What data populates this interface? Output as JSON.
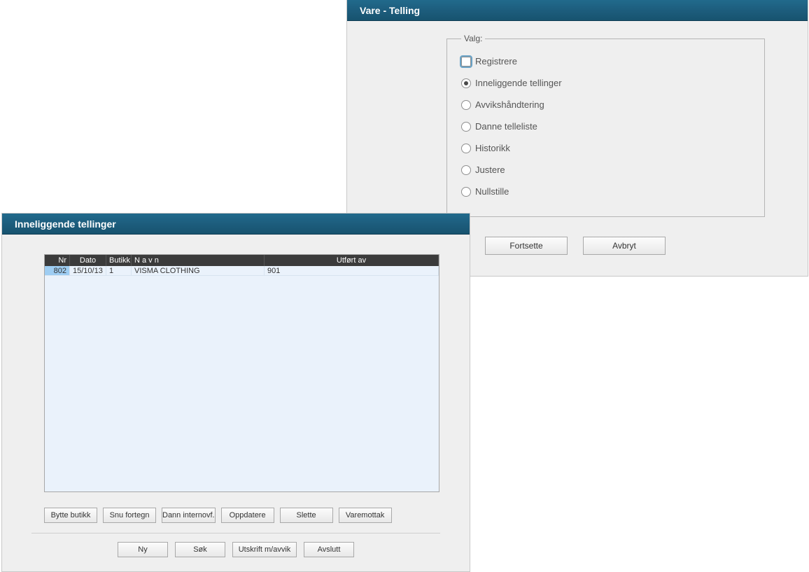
{
  "rightPanel": {
    "title": "Vare - Telling",
    "legend": "Valg:",
    "options": [
      {
        "label": "Registrere",
        "checked": false,
        "focused": true
      },
      {
        "label": "Inneliggende tellinger",
        "checked": true,
        "focused": false
      },
      {
        "label": "Avvikshåndtering",
        "checked": false,
        "focused": false
      },
      {
        "label": "Danne telleliste",
        "checked": false,
        "focused": false
      },
      {
        "label": "Historikk",
        "checked": false,
        "focused": false
      },
      {
        "label": "Justere",
        "checked": false,
        "focused": false
      },
      {
        "label": "Nullstille",
        "checked": false,
        "focused": false
      }
    ],
    "continueLabel": "Fortsette",
    "cancelLabel": "Avbryt"
  },
  "leftWindow": {
    "title": "Inneliggende tellinger",
    "columns": {
      "nr": "Nr",
      "dato": "Dato",
      "butikk": "Butikk",
      "navn": "N a v n",
      "utfort": "Utført av"
    },
    "rows": [
      {
        "nr": "802",
        "dato": "15/10/13",
        "butikk": "1",
        "navn": "VISMA CLOTHING",
        "utfort": "901"
      }
    ],
    "toolbar1": {
      "bytteButikk": "Bytte butikk",
      "snuFortegn": "Snu fortegn",
      "dannInternovf": "Dann internovf.",
      "oppdatere": "Oppdatere",
      "slette": "Slette",
      "varemottak": "Varemottak"
    },
    "toolbar2": {
      "ny": "Ny",
      "sok": "Søk",
      "utskriftMavvik": "Utskrift m/avvik",
      "avslutt": "Avslutt"
    }
  }
}
